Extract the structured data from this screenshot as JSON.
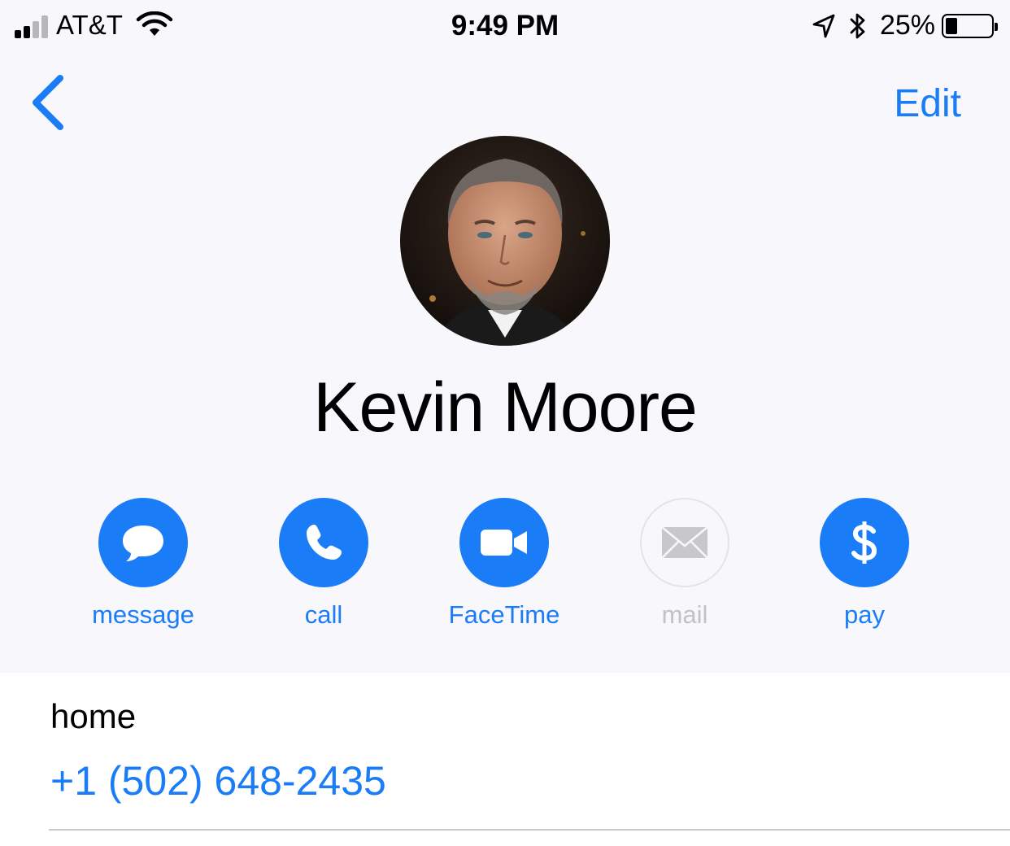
{
  "status_bar": {
    "carrier": "AT&T",
    "time": "9:49 PM",
    "battery_percent": "25%",
    "battery_level": 0.25,
    "signal_bars": 2,
    "icons": [
      "signal-icon",
      "wifi-icon",
      "location-arrow-icon",
      "bluetooth-icon",
      "battery-icon"
    ]
  },
  "nav": {
    "back_icon": "chevron-left-icon",
    "edit_label": "Edit"
  },
  "contact": {
    "name": "Kevin Moore",
    "avatar": "contact-photo"
  },
  "actions": [
    {
      "label": "message",
      "icon": "message-bubble-icon",
      "enabled": true
    },
    {
      "label": "call",
      "icon": "phone-icon",
      "enabled": true
    },
    {
      "label": "FaceTime",
      "icon": "video-camera-icon",
      "enabled": true
    },
    {
      "label": "mail",
      "icon": "envelope-icon",
      "enabled": false
    },
    {
      "label": "pay",
      "icon": "dollar-icon",
      "enabled": true
    }
  ],
  "phone": {
    "label": "home",
    "number": "+1 (502) 648-2435"
  },
  "colors": {
    "accent": "#1a7cf6",
    "background": "#f8f8fc",
    "disabled": "#c2c2c6"
  }
}
